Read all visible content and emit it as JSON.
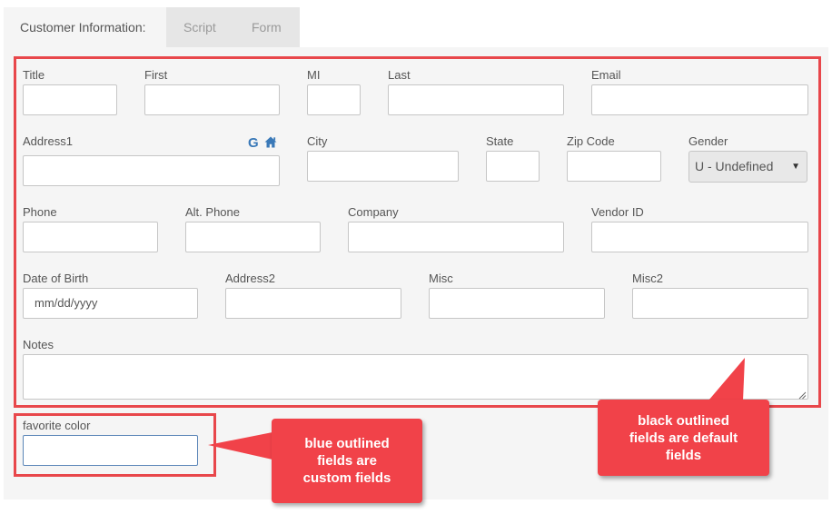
{
  "tabs": [
    {
      "label": "Customer Information:",
      "active": true
    },
    {
      "label": "Script",
      "active": false
    },
    {
      "label": "Form",
      "active": false
    }
  ],
  "fields": {
    "title": {
      "label": "Title",
      "value": ""
    },
    "first": {
      "label": "First",
      "value": ""
    },
    "mi": {
      "label": "MI",
      "value": ""
    },
    "last": {
      "label": "Last",
      "value": ""
    },
    "email": {
      "label": "Email",
      "value": ""
    },
    "address1": {
      "label": "Address1",
      "value": ""
    },
    "city": {
      "label": "City",
      "value": ""
    },
    "state": {
      "label": "State",
      "value": ""
    },
    "zip": {
      "label": "Zip Code",
      "value": ""
    },
    "gender": {
      "label": "Gender",
      "selected": "U - Undefined"
    },
    "phone": {
      "label": "Phone",
      "value": ""
    },
    "alt_phone": {
      "label": "Alt. Phone",
      "value": ""
    },
    "company": {
      "label": "Company",
      "value": ""
    },
    "vendor_id": {
      "label": "Vendor ID",
      "value": ""
    },
    "dob": {
      "label": "Date of Birth",
      "placeholder": "mm/dd/yyyy"
    },
    "address2": {
      "label": "Address2",
      "value": ""
    },
    "misc": {
      "label": "Misc",
      "value": ""
    },
    "misc2": {
      "label": "Misc2",
      "value": ""
    },
    "notes": {
      "label": "Notes",
      "value": ""
    },
    "favorite_color": {
      "label": "favorite color",
      "value": ""
    }
  },
  "icons": {
    "google": "G",
    "home": "home-icon"
  },
  "callouts": {
    "custom": [
      "blue outlined",
      "fields are",
      "custom fields"
    ],
    "default": [
      "black outlined",
      "fields are default",
      "fields"
    ]
  },
  "colors": {
    "callout": "#f14249",
    "outline": "#e8474b",
    "custom_field_border": "#5b86b8",
    "icon": "#3a79b8"
  }
}
